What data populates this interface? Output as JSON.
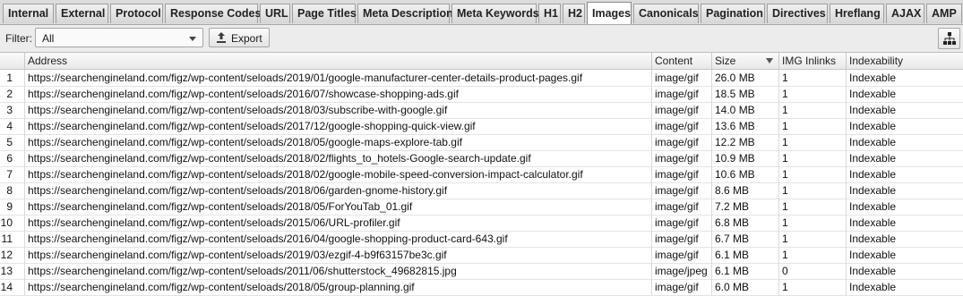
{
  "tabs": [
    {
      "label": "Internal",
      "width": 57
    },
    {
      "label": "External",
      "width": 59
    },
    {
      "label": "Protocol",
      "width": 59
    },
    {
      "label": "Response Codes",
      "width": 104
    },
    {
      "label": "URL",
      "width": 34
    },
    {
      "label": "Page Titles",
      "width": 71
    },
    {
      "label": "Meta Description",
      "width": 103
    },
    {
      "label": "Meta Keywords",
      "width": 95
    },
    {
      "label": "H1",
      "width": 25
    },
    {
      "label": "H2",
      "width": 25
    },
    {
      "label": "Images",
      "width": 50
    },
    {
      "label": "Canonicals",
      "width": 73
    },
    {
      "label": "Pagination",
      "width": 72
    },
    {
      "label": "Directives",
      "width": 68
    },
    {
      "label": "Hreflang",
      "width": 61
    },
    {
      "label": "AJAX",
      "width": 43
    },
    {
      "label": "AMP",
      "width": 40
    }
  ],
  "active_tab": "Images",
  "toolbar": {
    "filter_label": "Filter:",
    "filter_value": "All",
    "export_label": "Export"
  },
  "columns": [
    "",
    "Address",
    "Content",
    "Size",
    "IMG Inlinks",
    "Indexability"
  ],
  "rows": [
    [
      "1",
      "https://searchengineland.com/figz/wp-content/seloads/2019/01/google-manufacturer-center-details-product-pages.gif",
      "image/gif",
      "26.0 MB",
      "1",
      "Indexable"
    ],
    [
      "2",
      "https://searchengineland.com/figz/wp-content/seloads/2016/07/showcase-shopping-ads.gif",
      "image/gif",
      "18.5 MB",
      "1",
      "Indexable"
    ],
    [
      "3",
      "https://searchengineland.com/figz/wp-content/seloads/2018/03/subscribe-with-google.gif",
      "image/gif",
      "14.0 MB",
      "1",
      "Indexable"
    ],
    [
      "4",
      "https://searchengineland.com/figz/wp-content/seloads/2017/12/google-shopping-quick-view.gif",
      "image/gif",
      "13.6 MB",
      "1",
      "Indexable"
    ],
    [
      "5",
      "https://searchengineland.com/figz/wp-content/seloads/2018/05/google-maps-explore-tab.gif",
      "image/gif",
      "12.2 MB",
      "1",
      "Indexable"
    ],
    [
      "6",
      "https://searchengineland.com/figz/wp-content/seloads/2018/02/flights_to_hotels-Google-search-update.gif",
      "image/gif",
      "10.9 MB",
      "1",
      "Indexable"
    ],
    [
      "7",
      "https://searchengineland.com/figz/wp-content/seloads/2018/02/google-mobile-speed-conversion-impact-calculator.gif",
      "image/gif",
      "10.6 MB",
      "1",
      "Indexable"
    ],
    [
      "8",
      "https://searchengineland.com/figz/wp-content/seloads/2018/06/garden-gnome-history.gif",
      "image/gif",
      "8.6 MB",
      "1",
      "Indexable"
    ],
    [
      "9",
      "https://searchengineland.com/figz/wp-content/seloads/2018/05/ForYouTab_01.gif",
      "image/gif",
      "7.2 MB",
      "1",
      "Indexable"
    ],
    [
      "10",
      "https://searchengineland.com/figz/wp-content/seloads/2015/06/URL-profiler.gif",
      "image/gif",
      "6.8 MB",
      "1",
      "Indexable"
    ],
    [
      "11",
      "https://searchengineland.com/figz/wp-content/seloads/2016/04/google-shopping-product-card-643.gif",
      "image/gif",
      "6.7 MB",
      "1",
      "Indexable"
    ],
    [
      "12",
      "https://searchengineland.com/figz/wp-content/seloads/2019/03/ezgif-4-b9f63157be3c.gif",
      "image/gif",
      "6.1 MB",
      "1",
      "Indexable"
    ],
    [
      "13",
      "https://searchengineland.com/figz/wp-content/seloads/2011/06/shutterstock_49682815.jpg",
      "image/jpeg",
      "6.1 MB",
      "0",
      "Indexable"
    ],
    [
      "14",
      "https://searchengineland.com/figz/wp-content/seloads/2018/05/group-planning.gif",
      "image/gif",
      "6.0 MB",
      "1",
      "Indexable"
    ]
  ]
}
